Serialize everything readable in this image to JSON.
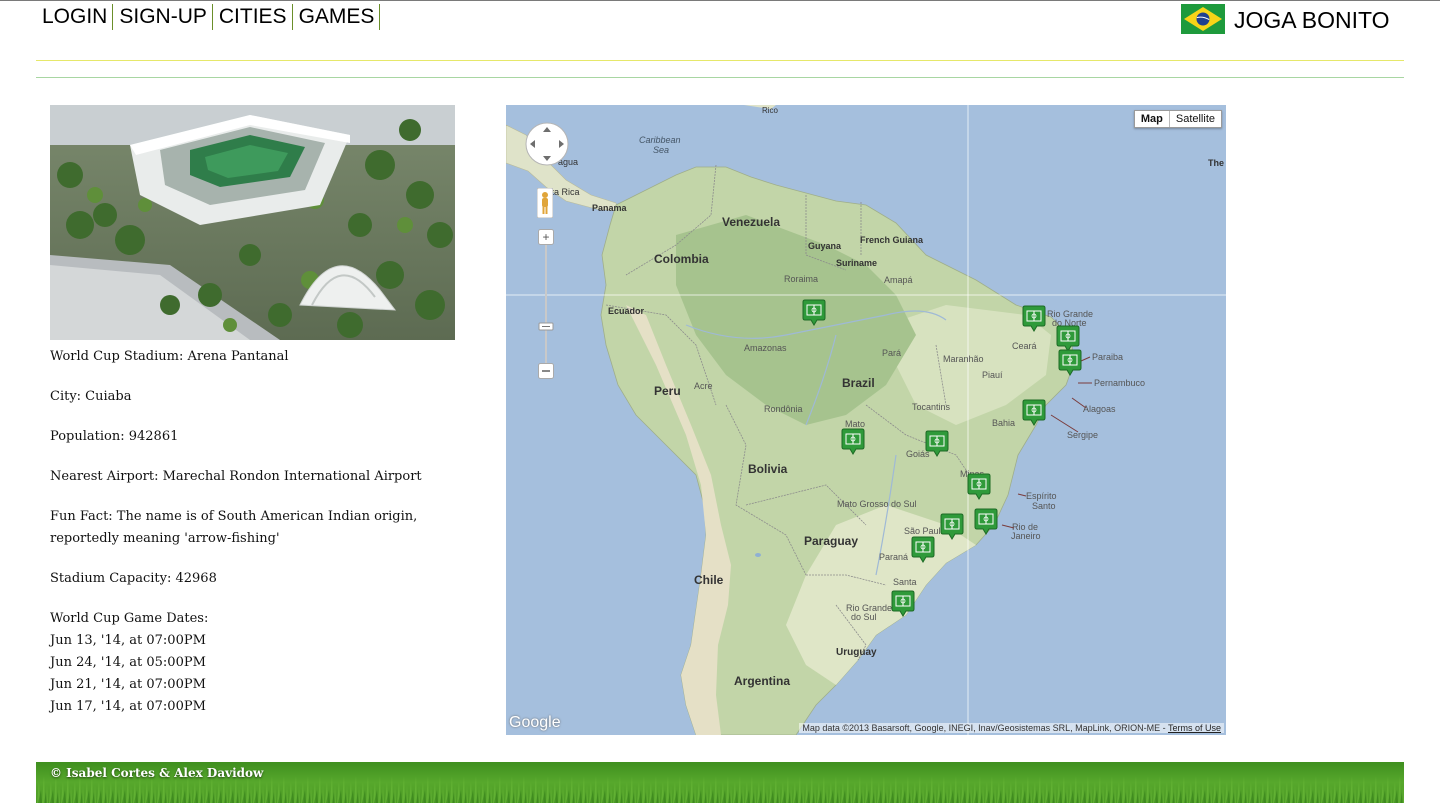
{
  "nav": {
    "items": [
      "LOGIN",
      "SIGN-UP",
      "CITIES",
      "GAMES"
    ]
  },
  "brand": {
    "name": "JOGA BONITO",
    "flag_icon": "brazil-flag-icon"
  },
  "stadium": {
    "name_line": "World Cup Stadium: Arena Pantanal",
    "city_line": "City: Cuiaba",
    "population_line": "Population: 942861",
    "airport_line": "Nearest Airport: Marechal Rondon International Airport",
    "funfact_line": "Fun Fact: The name is of South American Indian origin, reportedly meaning 'arrow-fishing'",
    "capacity_line": "Stadium Capacity: 42968",
    "dates_heading": "World Cup Game Dates:",
    "dates": [
      "Jun 13, '14, at 07:00PM",
      "Jun 24, '14, at 05:00PM",
      "Jun 21, '14, at 07:00PM",
      "Jun 17, '14, at 07:00PM"
    ]
  },
  "map": {
    "type_buttons": {
      "map": "Map",
      "satellite": "Satellite"
    },
    "attribution": "Map data ©2013 Basarsoft, Google, INEGI, Inav/Geosistemas SRL, MapLink, ORION-ME - ",
    "terms": "Terms of Use",
    "logo": "Google",
    "labels": {
      "rico": "Rico",
      "caribbean": "Caribbean",
      "sea": "Sea",
      "nicaragua": "agua",
      "costarica": "osta Rica",
      "panama": "Panama",
      "venezuela": "Venezuela",
      "guyana": "Guyana",
      "frenchguiana": "French Guiana",
      "suriname": "Suriname",
      "colombia": "Colombia",
      "roraima": "Roraima",
      "amapa": "Amapá",
      "ecuador": "Ecuador",
      "amazonas": "Amazonas",
      "para": "Pará",
      "maranhao": "Maranhão",
      "ceara": "Ceará",
      "riograndenorte1": "Rio Grande",
      "riograndenorte2": "do Norte",
      "paraiba": "Paraiba",
      "pernambuco": "Pernambuco",
      "piaui": "Piauí",
      "peru": "Peru",
      "acre": "Acre",
      "brazil": "Brazil",
      "rondonia": "Rondônia",
      "tocantins": "Tocantins",
      "alagoas": "Alagoas",
      "bahia": "Bahia",
      "sergipe": "Sergipe",
      "matogrosso": "Mato",
      "goias": "Goiás",
      "bolivia": "Bolivia",
      "minas": "Minas",
      "espiritosanto1": "Espírito",
      "espiritosanto2": "Santo",
      "matogrossosul": "Mato Grosso do Sul",
      "saopaulo": "São Paulo",
      "riodejaneiro1": "Rio de",
      "riodejaneiro2": "Janeiro",
      "paraguay": "Paraguay",
      "parana": "Paraná",
      "chile": "Chile",
      "santa": "Santa",
      "riograndesul1": "Rio Grande",
      "riograndesul2": "do Sul",
      "uruguay": "Uruguay",
      "argentina": "Argentina",
      "the": "The"
    }
  },
  "footer": {
    "text": "© Isabel Cortes & Alex Davidow"
  }
}
